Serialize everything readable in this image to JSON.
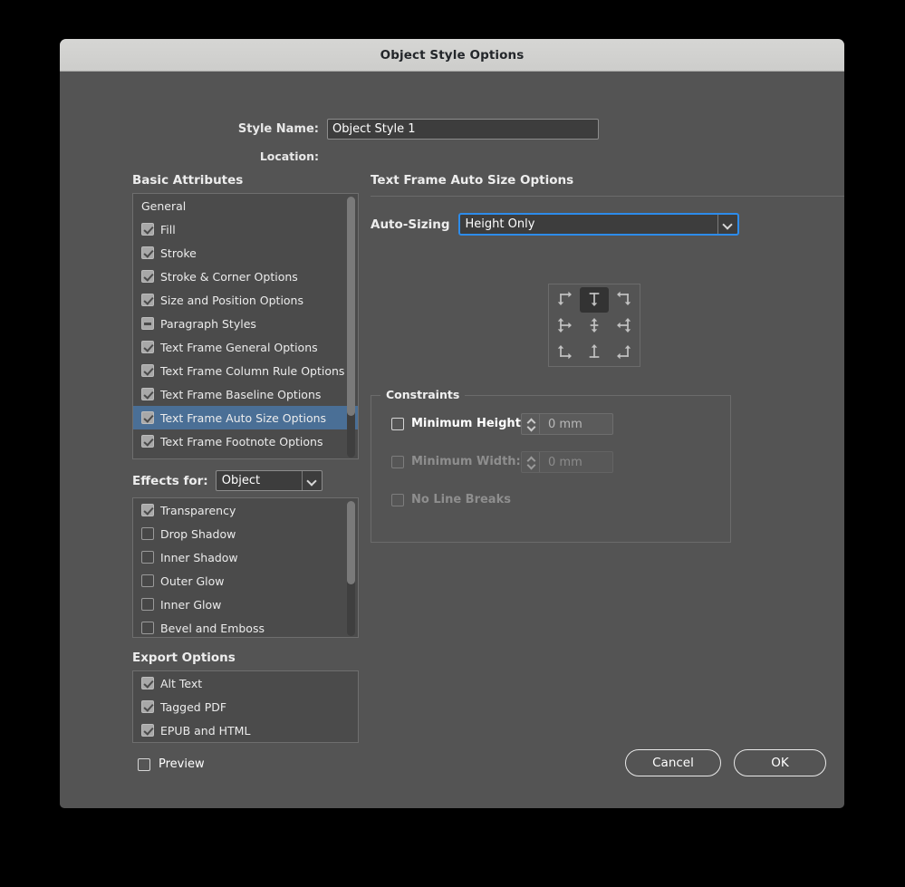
{
  "window": {
    "title": "Object Style Options"
  },
  "form": {
    "style_name_label": "Style Name:",
    "style_name_value": "Object Style 1",
    "location_label": "Location:",
    "location_value": ""
  },
  "basic_attributes": {
    "heading": "Basic Attributes",
    "items": [
      {
        "label": "General",
        "checkbox": "none",
        "selected": false
      },
      {
        "label": "Fill",
        "checkbox": "checked",
        "selected": false
      },
      {
        "label": "Stroke",
        "checkbox": "checked",
        "selected": false
      },
      {
        "label": "Stroke & Corner Options",
        "checkbox": "checked",
        "selected": false
      },
      {
        "label": "Size and Position Options",
        "checkbox": "checked",
        "selected": false
      },
      {
        "label": "Paragraph Styles",
        "checkbox": "dash",
        "selected": false
      },
      {
        "label": "Text Frame General Options",
        "checkbox": "checked",
        "selected": false
      },
      {
        "label": "Text Frame Column Rule Options",
        "checkbox": "checked",
        "selected": false
      },
      {
        "label": "Text Frame Baseline Options",
        "checkbox": "checked",
        "selected": false
      },
      {
        "label": "Text Frame Auto Size Options",
        "checkbox": "checked",
        "selected": true
      },
      {
        "label": "Text Frame Footnote Options",
        "checkbox": "checked",
        "selected": false
      }
    ]
  },
  "effects": {
    "for_label": "Effects for:",
    "for_value": "Object",
    "items": [
      {
        "label": "Transparency",
        "checkbox": "checked"
      },
      {
        "label": "Drop Shadow",
        "checkbox": "off"
      },
      {
        "label": "Inner Shadow",
        "checkbox": "off"
      },
      {
        "label": "Outer Glow",
        "checkbox": "off"
      },
      {
        "label": "Inner Glow",
        "checkbox": "off"
      },
      {
        "label": "Bevel and Emboss",
        "checkbox": "off"
      }
    ]
  },
  "export_options": {
    "heading": "Export Options",
    "items": [
      {
        "label": "Alt Text",
        "checkbox": "checked"
      },
      {
        "label": "Tagged PDF",
        "checkbox": "checked"
      },
      {
        "label": "EPUB and HTML",
        "checkbox": "checked"
      }
    ]
  },
  "panel": {
    "heading": "Text Frame Auto Size Options",
    "auto_sizing_label": "Auto-Sizing",
    "auto_sizing_value": "Height Only",
    "reference_grid": [
      {
        "name": "top-left",
        "icon": "arrow-right-down",
        "selected": false
      },
      {
        "name": "top-center",
        "icon": "arrow-down",
        "selected": true
      },
      {
        "name": "top-right",
        "icon": "arrow-left-down",
        "selected": false
      },
      {
        "name": "middle-left",
        "icon": "arrow-right-updown",
        "selected": false
      },
      {
        "name": "middle-center",
        "icon": "arrow-updown",
        "selected": false
      },
      {
        "name": "middle-right",
        "icon": "arrow-left-updown",
        "selected": false
      },
      {
        "name": "bottom-left",
        "icon": "arrow-right-up",
        "selected": false
      },
      {
        "name": "bottom-center",
        "icon": "arrow-up",
        "selected": false
      },
      {
        "name": "bottom-right",
        "icon": "arrow-left-up",
        "selected": false
      }
    ]
  },
  "constraints": {
    "legend": "Constraints",
    "minimum_height": {
      "label": "Minimum Height:",
      "checked": false,
      "value": "0 mm",
      "disabled": false
    },
    "minimum_width": {
      "label": "Minimum Width:",
      "checked": false,
      "value": "0 mm",
      "disabled": true
    },
    "no_line_breaks": {
      "label": "No Line Breaks",
      "checked": false,
      "disabled": true
    }
  },
  "footer": {
    "preview_label": "Preview",
    "preview_checked": false,
    "cancel_label": "Cancel",
    "ok_label": "OK"
  },
  "colors": {
    "dialog_bg": "#545454",
    "titlebar_bg": "#d2d2d0",
    "selection_blue": "#4a6f96",
    "focus_blue": "#2d8ceb",
    "list_bg": "#4b4b4b"
  }
}
